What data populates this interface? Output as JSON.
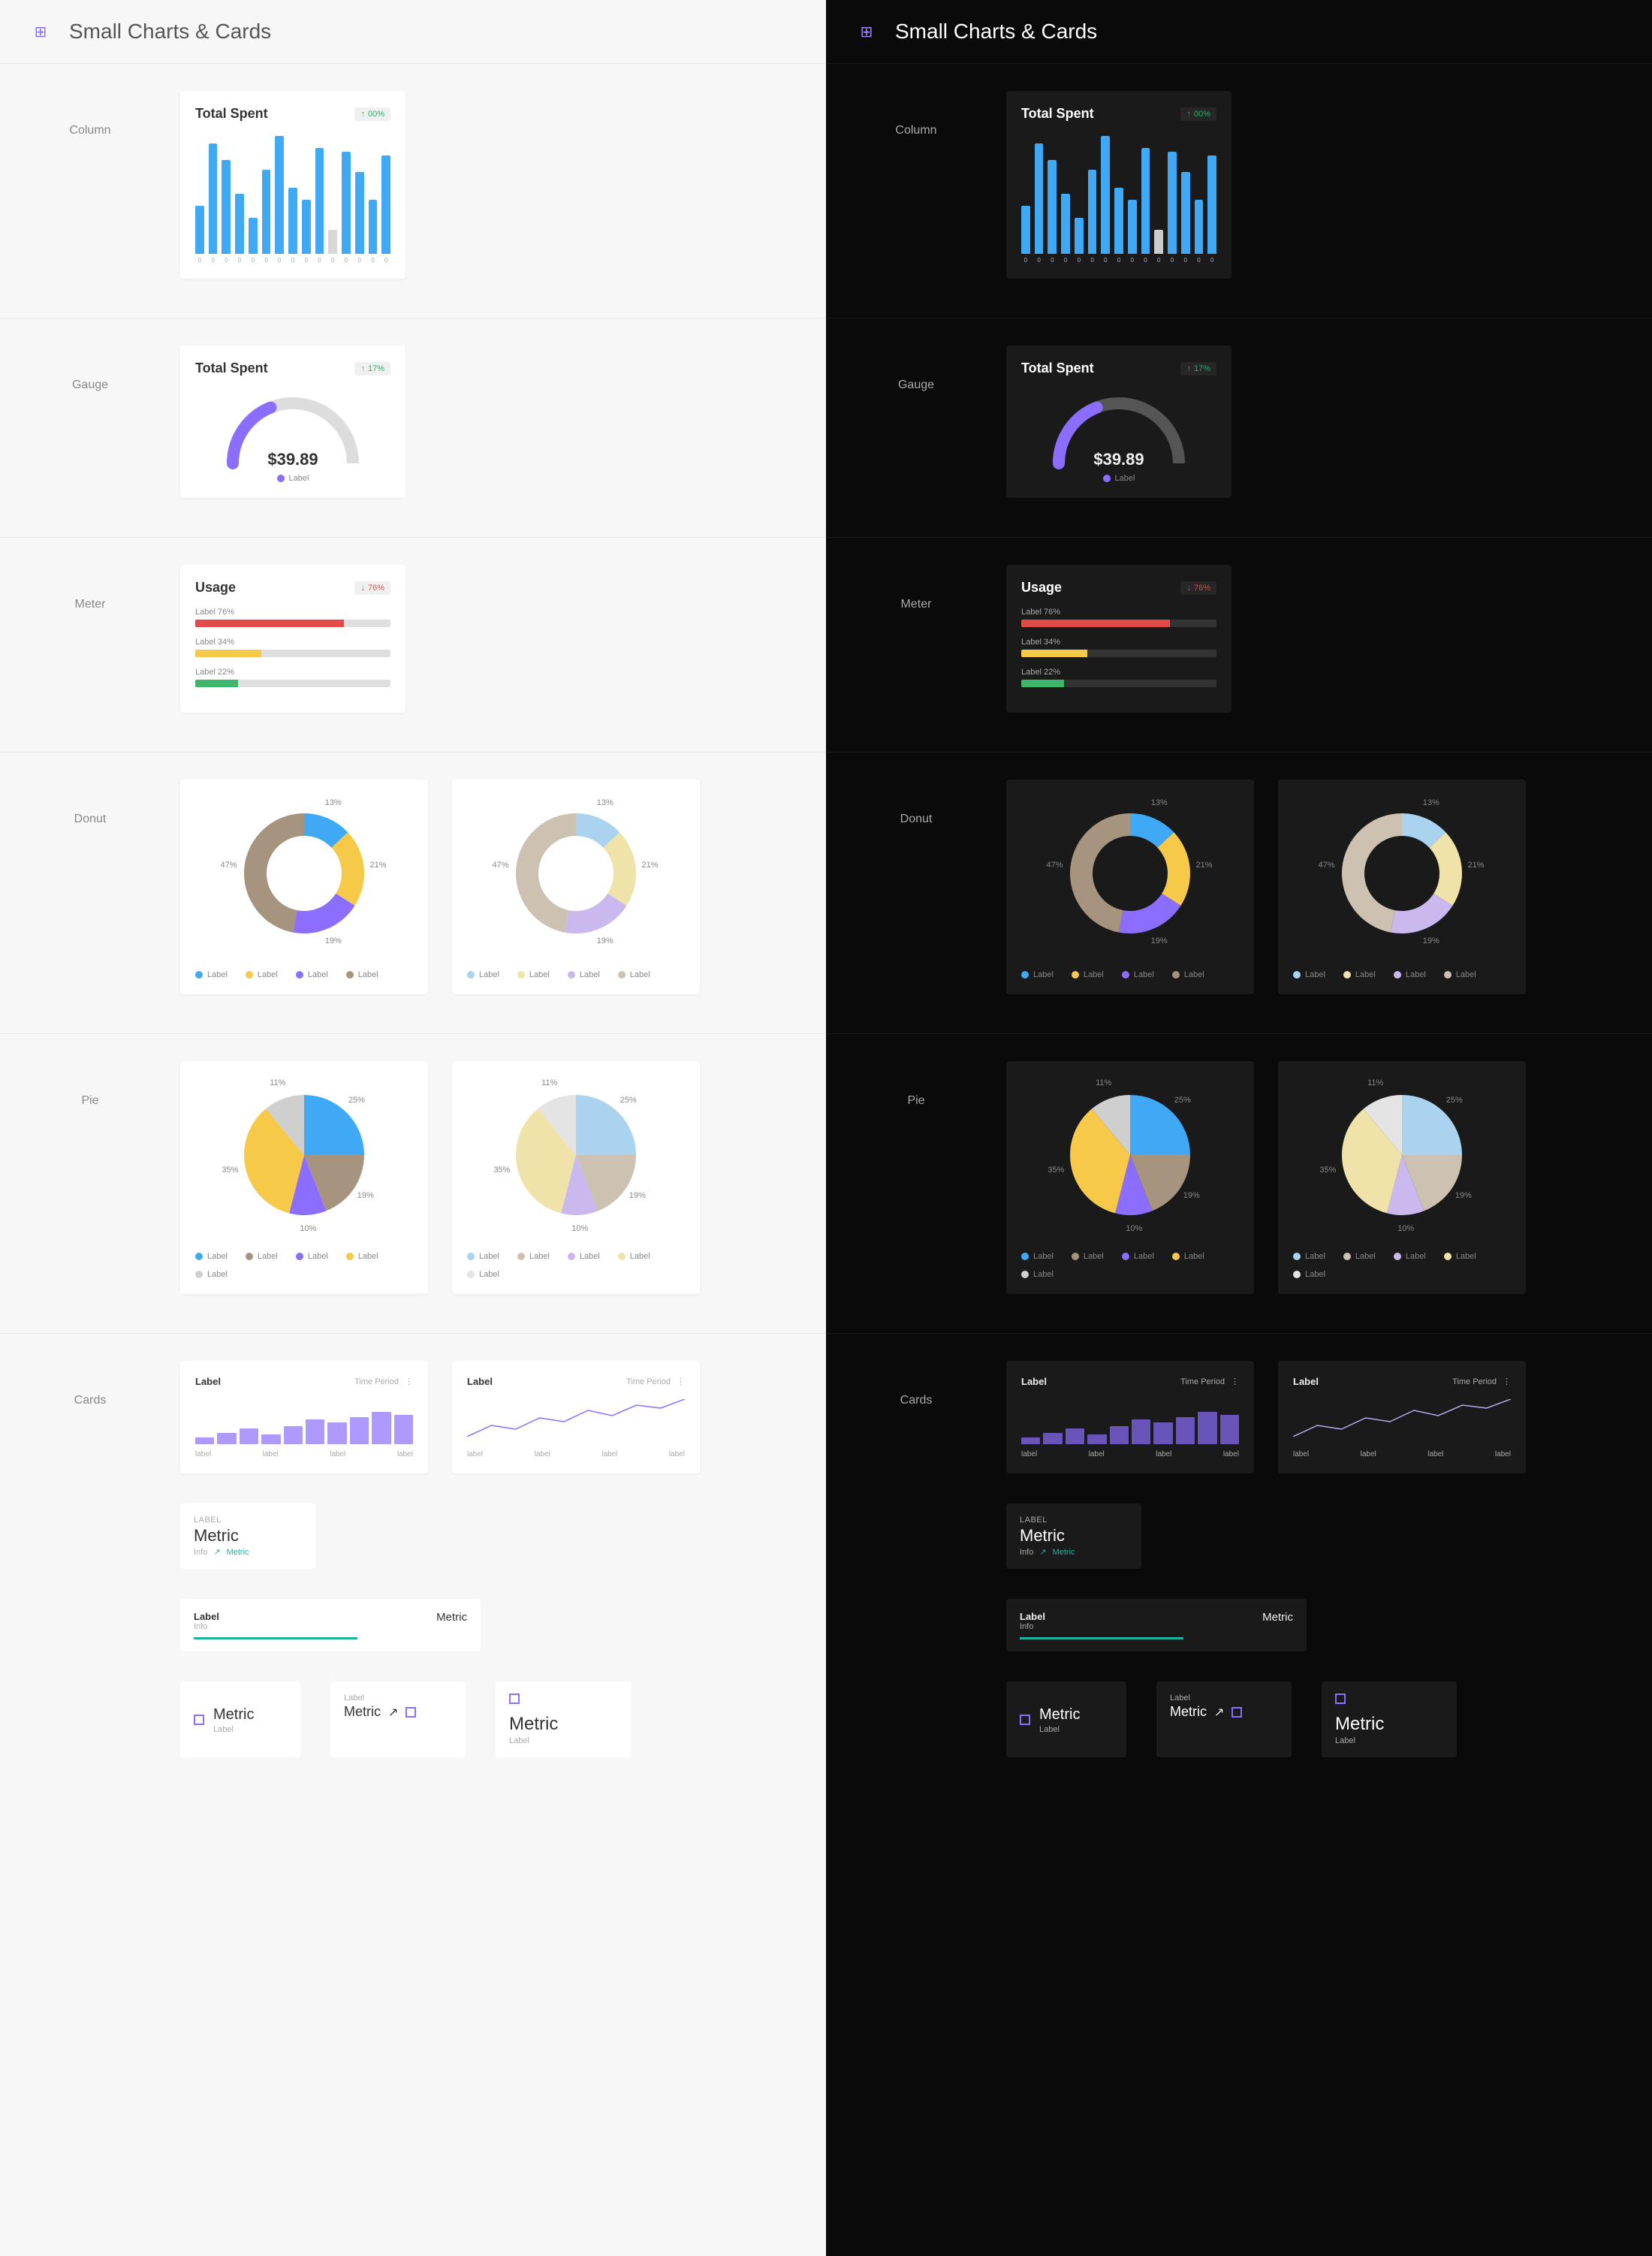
{
  "chart_data": [
    {
      "type": "bar",
      "title": "Total Spent",
      "delta": "00%",
      "categories": [
        "0",
        "0",
        "0",
        "0",
        "0",
        "0",
        "0",
        "0",
        "0",
        "0",
        "0",
        "0",
        "0",
        "0",
        "0"
      ],
      "values": [
        40,
        92,
        78,
        50,
        30,
        70,
        98,
        55,
        45,
        88,
        20,
        85,
        68,
        45,
        82
      ]
    },
    {
      "type": "gauge",
      "title": "Total Spent",
      "delta": "17%",
      "value": "$39.89",
      "fill_pct": 38,
      "legend": "Label",
      "color": "#8b6dff"
    },
    {
      "type": "bar",
      "title": "Usage",
      "delta": "76%",
      "series": [
        {
          "name": "Label 76%",
          "value": 76,
          "color": "#e34b4b"
        },
        {
          "name": "Label 34%",
          "value": 34,
          "color": "#f7c948"
        },
        {
          "name": "Label 22%",
          "value": 22,
          "color": "#3fb56c"
        }
      ]
    },
    {
      "type": "pie",
      "variant": "donut",
      "series": [
        {
          "name": "Label",
          "value": 13,
          "color": "#3fa9f5"
        },
        {
          "name": "Label",
          "value": 21,
          "color": "#f7c948"
        },
        {
          "name": "Label",
          "value": 19,
          "color": "#8b6dff"
        },
        {
          "name": "Label",
          "value": 47,
          "color": "#a6947f"
        }
      ],
      "legend": [
        "Label",
        "Label",
        "Label",
        "Label"
      ]
    },
    {
      "type": "pie",
      "variant": "donut-muted",
      "series": [
        {
          "name": "Label",
          "value": 13,
          "color": "#a9d3ef"
        },
        {
          "name": "Label",
          "value": 21,
          "color": "#efe3a9"
        },
        {
          "name": "Label",
          "value": 19,
          "color": "#c9b9ef"
        },
        {
          "name": "Label",
          "value": 47,
          "color": "#cdc1b1"
        }
      ],
      "legend": [
        "Label",
        "Label",
        "Label",
        "Label"
      ]
    },
    {
      "type": "pie",
      "series": [
        {
          "name": "Label",
          "value": 25,
          "color": "#3fa9f5"
        },
        {
          "name": "Label",
          "value": 19,
          "color": "#a6947f"
        },
        {
          "name": "Label",
          "value": 10,
          "color": "#8b6dff"
        },
        {
          "name": "Label",
          "value": 35,
          "color": "#f7c948"
        },
        {
          "name": "Label",
          "value": 11,
          "color": "#cfcfcf"
        }
      ],
      "legend": [
        "Label",
        "Label",
        "Label",
        "Label",
        "Label"
      ]
    },
    {
      "type": "pie",
      "variant": "muted",
      "series": [
        {
          "name": "Label",
          "value": 25,
          "color": "#a9d3ef"
        },
        {
          "name": "Label",
          "value": 19,
          "color": "#cdc1b1"
        },
        {
          "name": "Label",
          "value": 10,
          "color": "#c9b9ef"
        },
        {
          "name": "Label",
          "value": 35,
          "color": "#efe3a9"
        },
        {
          "name": "Label",
          "value": 11,
          "color": "#e4e4e4"
        }
      ],
      "legend": [
        "Label",
        "Label",
        "Label",
        "Label",
        "Label"
      ]
    },
    {
      "type": "bar",
      "variant": "sparkcolumn",
      "title": "Label",
      "period": "Time Period",
      "categories": [
        "label",
        "label",
        "label",
        "label"
      ],
      "values": [
        15,
        25,
        35,
        22,
        40,
        55,
        48,
        60,
        72,
        65
      ]
    },
    {
      "type": "line",
      "variant": "sparkline",
      "title": "Label",
      "period": "Time Period",
      "categories": [
        "label",
        "label",
        "label",
        "label"
      ],
      "values": [
        20,
        35,
        30,
        45,
        40,
        55,
        48,
        62,
        58,
        70
      ]
    }
  ],
  "page_title": "Small Charts & Cards",
  "sections": {
    "column": "Column",
    "gauge": "Gauge",
    "meter": "Meter",
    "donut": "Donut",
    "pie": "Pie",
    "cards": "Cards"
  },
  "meter": {
    "title": "Usage",
    "delta": "76%",
    "rows": [
      {
        "label": "Label 76%",
        "pct": 76,
        "color": "#e34b4b"
      },
      {
        "label": "Label 34%",
        "pct": 34,
        "color": "#f7c948"
      },
      {
        "label": "Label 22%",
        "pct": 22,
        "color": "#3fb56c"
      }
    ]
  },
  "donut": {
    "labels": [
      "13%",
      "21%",
      "19%",
      "47%"
    ],
    "legend": "Label"
  },
  "pie": {
    "labels": [
      "25%",
      "19%",
      "10%",
      "35%",
      "11%"
    ],
    "legend": "Label"
  },
  "cards": {
    "mini": {
      "label": "LABEL",
      "metric": "Metric",
      "info": "Info",
      "extra": "Metric"
    },
    "bar": {
      "label": "Label",
      "info": "Info",
      "metric": "Metric"
    },
    "smalls": [
      {
        "metric": "Metric",
        "label": "Label"
      },
      {
        "label": "Label",
        "metric": "Metric"
      },
      {
        "metric": "Metric",
        "label": "Label"
      }
    ]
  },
  "colors": {
    "blue": "#3fa9f5",
    "purple": "#8b6dff",
    "yellow": "#f7c948",
    "brown": "#a6947f",
    "grey": "#cfcfcf",
    "teal": "#1db5a0"
  }
}
